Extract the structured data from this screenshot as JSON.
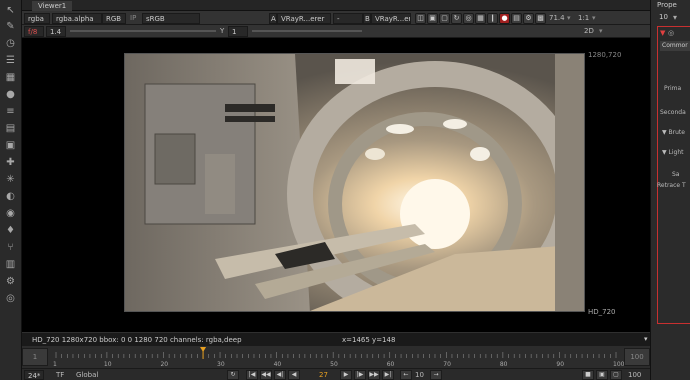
{
  "tabs": {
    "viewer": "Viewer1"
  },
  "toolbar1": {
    "channels": "rgba",
    "alpha": "rgba.alpha",
    "colorspace": "RGB",
    "ip": "IP",
    "lut": "sRGB",
    "input_a_letter": "A",
    "input_a": "VRayR...erer",
    "dash": "-",
    "input_b_letter": "B",
    "input_b": "VRayR...erer",
    "zoom": "71.4",
    "ratio": "1:1"
  },
  "toolbar2": {
    "fstop": "f/8",
    "gain": "1.4",
    "y_label": "Y",
    "gamma": "1",
    "mode": "2D"
  },
  "viewer": {
    "res_top_right": "1280,720",
    "res_bottom_right": "HD_720"
  },
  "status": {
    "info": "HD_720 1280x720  bbox: 0 0 1280 720 channels: rgba,deep",
    "coords": "x=1465 y=148"
  },
  "timeline": {
    "start": "1",
    "end": "100",
    "ticks": [
      "1",
      "10",
      "20",
      "30",
      "40",
      "50",
      "60",
      "70",
      "80",
      "90",
      "100"
    ],
    "current_marker": 27
  },
  "playbar": {
    "fps": "24*",
    "tf": "TF",
    "scope": "Global",
    "frame": "27",
    "step": "10",
    "end": "100"
  },
  "right_panel": {
    "tab": "Prope",
    "count": "10",
    "section": "Commor",
    "items": [
      "Prima",
      "Seconda",
      "Brute",
      "Light",
      "Sa",
      "Retrace T"
    ]
  },
  "colors": {
    "accent": "#e8a020",
    "tab_highlight": "#c83030"
  },
  "icons": [
    "arrow-icon",
    "brush-icon",
    "menu-icon",
    "grid-icon",
    "circle-icon",
    "bars-icon",
    "layers-icon",
    "cube-icon",
    "move-icon",
    "sparkle-icon",
    "light-icon",
    "eye-icon",
    "tag-icon",
    "tree-icon",
    "stack-icon",
    "gear-icon",
    "logo-icon"
  ]
}
